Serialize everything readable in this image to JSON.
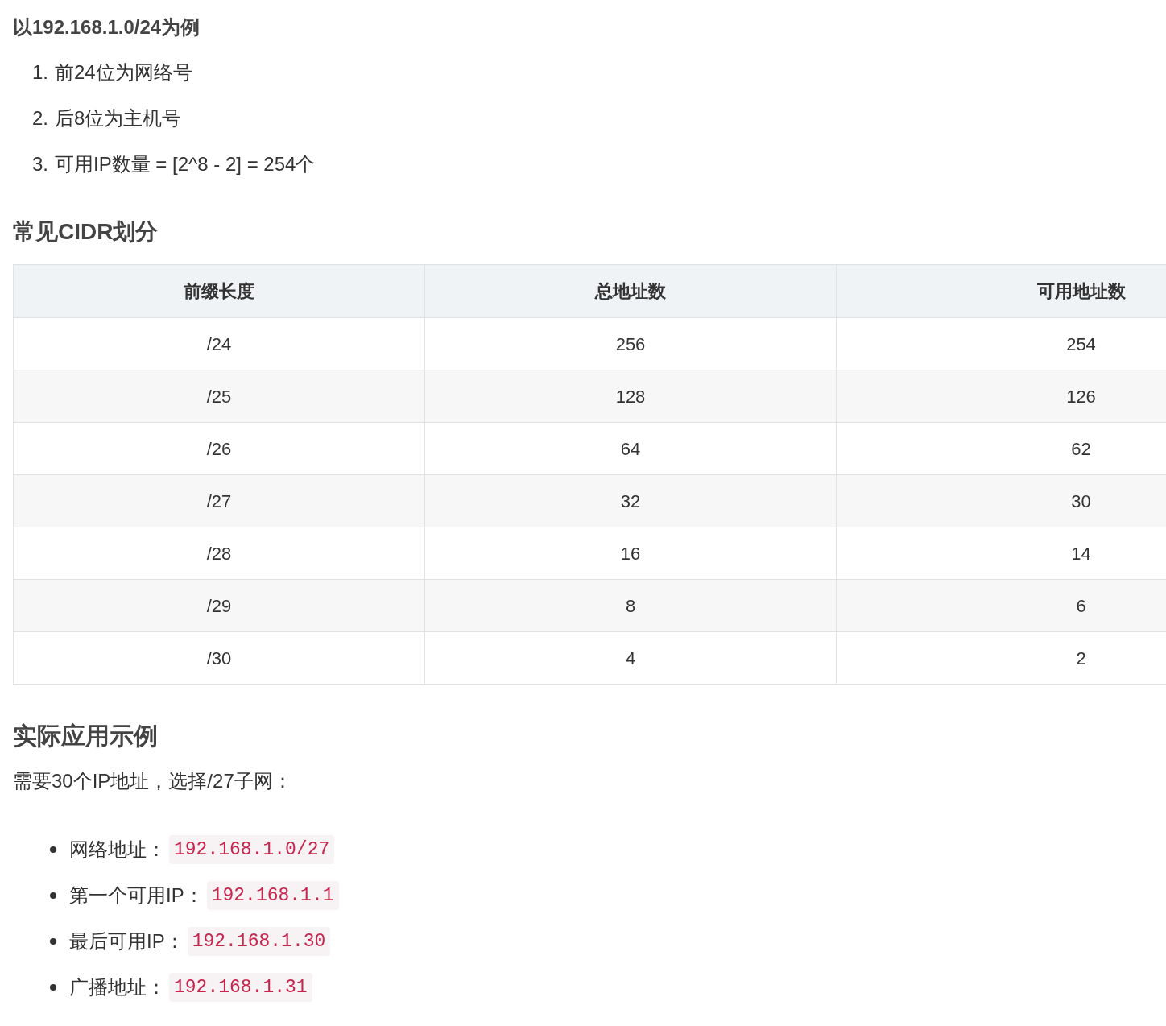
{
  "intro": "以192.168.1.0/24为例",
  "steps": [
    {
      "marker": "1.",
      "text": "前24位为网络号"
    },
    {
      "marker": "2.",
      "text": "后8位为主机号"
    },
    {
      "marker": "3.",
      "text": "可用IP数量 = [2^8 - 2] = 254个"
    }
  ],
  "cidr_heading": "常见CIDR划分",
  "table": {
    "columns": [
      "前缀长度",
      "总地址数",
      "可用地址数"
    ],
    "rows": [
      [
        "/24",
        "256",
        "254"
      ],
      [
        "/25",
        "128",
        "126"
      ],
      [
        "/26",
        "64",
        "62"
      ],
      [
        "/27",
        "32",
        "30"
      ],
      [
        "/28",
        "16",
        "14"
      ],
      [
        "/29",
        "8",
        "6"
      ],
      [
        "/30",
        "4",
        "2"
      ]
    ]
  },
  "example_heading": "实际应用示例",
  "example_text": "需要30个IP地址，选择/27子网：",
  "addresses": [
    {
      "label": "网络地址：",
      "code": "192.168.1.0/27"
    },
    {
      "label": "第一个可用IP：",
      "code": "192.168.1.1"
    },
    {
      "label": "最后可用IP：",
      "code": "192.168.1.30"
    },
    {
      "label": "广播地址：",
      "code": "192.168.1.31"
    }
  ]
}
